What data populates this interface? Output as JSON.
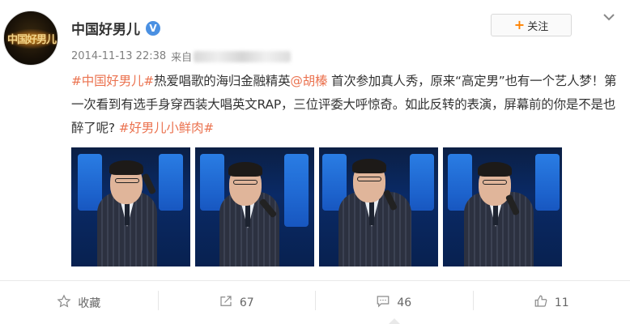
{
  "author": {
    "name": "中国好男儿",
    "avatar_text": "中国好男儿",
    "verified": true
  },
  "meta": {
    "timestamp": "2014-11-13 22:38",
    "source_prefix": "来自"
  },
  "follow": {
    "label": "关注"
  },
  "post": {
    "hashtag_show": "#中国好男儿#",
    "text_a": "热爱唱歌的海归金融精英",
    "mention": "@胡榛",
    "text_b": " 首次参加真人秀，原来“高定男”也有一个艺人梦！第一次看到有选手身穿西装大唱英文RAP，三位评委大呼惊奇。如此反转的表演，屏幕前的你是不是也醉了呢? ",
    "hashtag_end": "#好男儿小鲜肉#"
  },
  "photos_count": 4,
  "actions": {
    "favorite": {
      "icon": "star-icon",
      "label": "收藏"
    },
    "repost": {
      "icon": "share-icon",
      "count": "67"
    },
    "comment": {
      "icon": "comment-icon",
      "count": "46"
    },
    "like": {
      "icon": "thumbs-up-icon",
      "count": "11"
    }
  },
  "colors": {
    "link": "#eb7350",
    "follow_plus": "#ff8200",
    "verified": "#4a90e2"
  }
}
